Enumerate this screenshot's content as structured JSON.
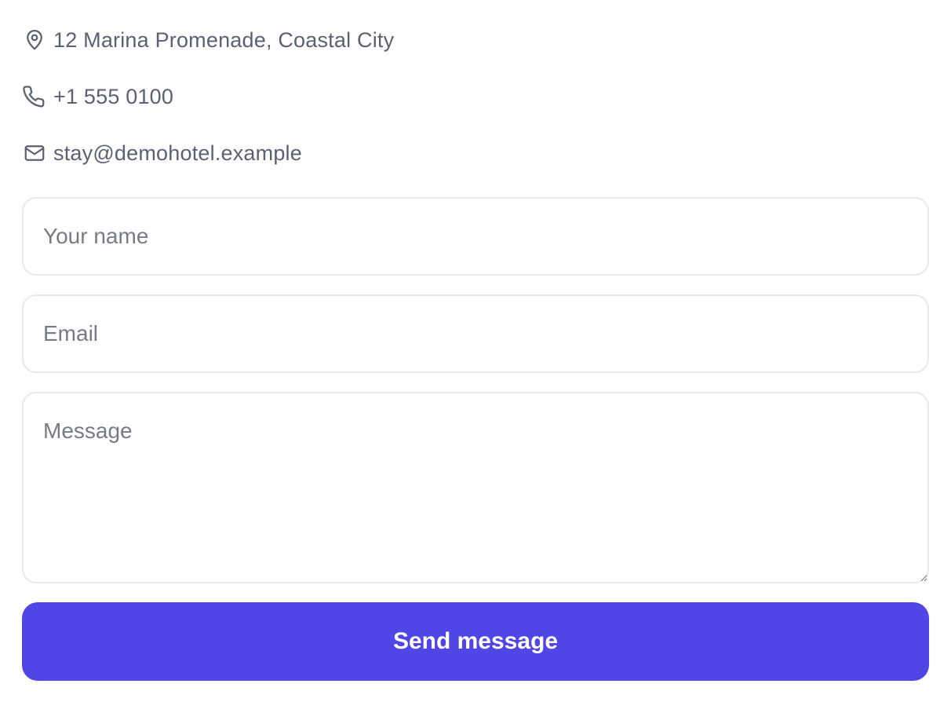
{
  "contact": {
    "address": {
      "icon": "map-pin-icon",
      "text": "12 Marina Promenade, Coastal City"
    },
    "phone": {
      "icon": "phone-icon",
      "text": "+1 555 0100"
    },
    "email": {
      "icon": "mail-icon",
      "text": "stay@demohotel.example"
    }
  },
  "form": {
    "name": {
      "placeholder": "Your name",
      "value": ""
    },
    "email": {
      "placeholder": "Email",
      "value": ""
    },
    "message": {
      "placeholder": "Message",
      "value": ""
    },
    "submit_label": "Send message"
  },
  "colors": {
    "accent": "#4f46e5",
    "text_muted": "#5b6172",
    "border": "#e8e9ee"
  }
}
